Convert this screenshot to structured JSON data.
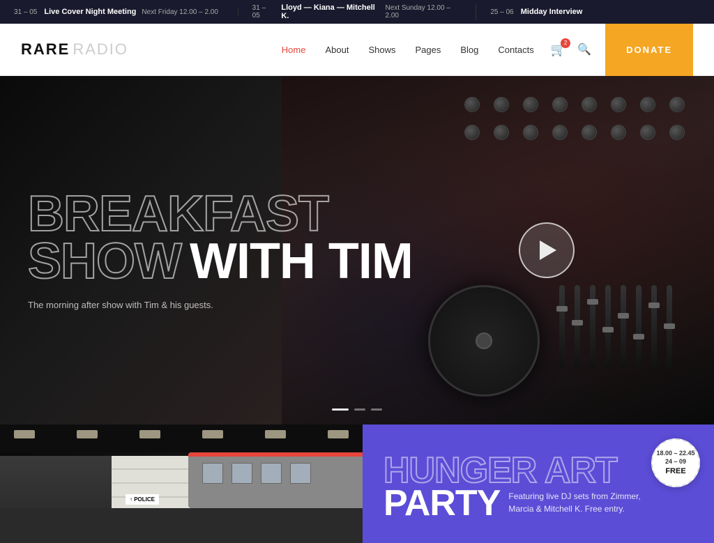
{
  "ticker": {
    "items": [
      {
        "date": "31 – 05",
        "title": "Live Cover Night Meeting",
        "time": "Next Friday 12.00 – 2.00"
      },
      {
        "date": "31 – 05",
        "title": "Lloyd — Kiana — Mitchell K.",
        "time": "Next Sunday 12.00 – 2.00"
      },
      {
        "date": "25 – 06",
        "title": "Midday Interview",
        "time": ""
      }
    ]
  },
  "header": {
    "logo_bold": "RARE",
    "logo_light": "RADIO",
    "nav": [
      {
        "label": "Home",
        "active": true
      },
      {
        "label": "About",
        "active": false
      },
      {
        "label": "Shows",
        "active": false
      },
      {
        "label": "Pages",
        "active": false
      },
      {
        "label": "Blog",
        "active": false
      },
      {
        "label": "Contacts",
        "active": false
      }
    ],
    "cart_count": "2",
    "donate_label": "DONATE"
  },
  "hero": {
    "title_line1_outline": "BREAKFAST",
    "title_line2a_outline": "SHOW",
    "title_line2b_filled": "WITH TIM",
    "subtitle": "The morning after show with Tim & his guests.",
    "dots": [
      {
        "active": true
      },
      {
        "active": false
      },
      {
        "active": false
      }
    ]
  },
  "event": {
    "badge_time": "18.00 – 22.45",
    "badge_date": "24 – 09",
    "badge_free": "FREE",
    "title_outline": "HUNGER ART",
    "title_filled": "PARTY",
    "description": "Featuring live DJ sets from Zimmer, Marcia & Mitchell K. Free entry."
  },
  "subway_sign": "↑ POLICE"
}
